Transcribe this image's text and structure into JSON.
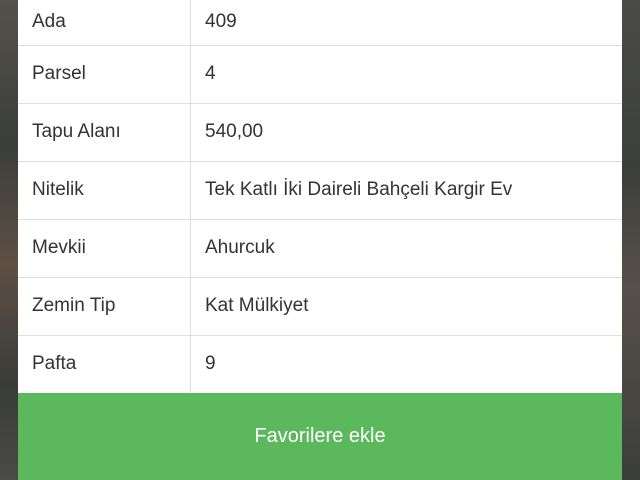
{
  "details": {
    "rows": [
      {
        "label": "Ada",
        "value": "409"
      },
      {
        "label": "Parsel",
        "value": "4"
      },
      {
        "label": "Tapu Alanı",
        "value": "540,00"
      },
      {
        "label": "Nitelik",
        "value": "Tek Katlı İki Daireli Bahçeli Kargir Ev"
      },
      {
        "label": "Mevkii",
        "value": "Ahurcuk"
      },
      {
        "label": "Zemin Tip",
        "value": "Kat Mülkiyet"
      },
      {
        "label": "Pafta",
        "value": "9"
      }
    ]
  },
  "actions": {
    "favorite_label": "Favorilere ekle"
  },
  "colors": {
    "button_green": "#5cb85c",
    "border": "#dedede",
    "text": "#333333"
  }
}
